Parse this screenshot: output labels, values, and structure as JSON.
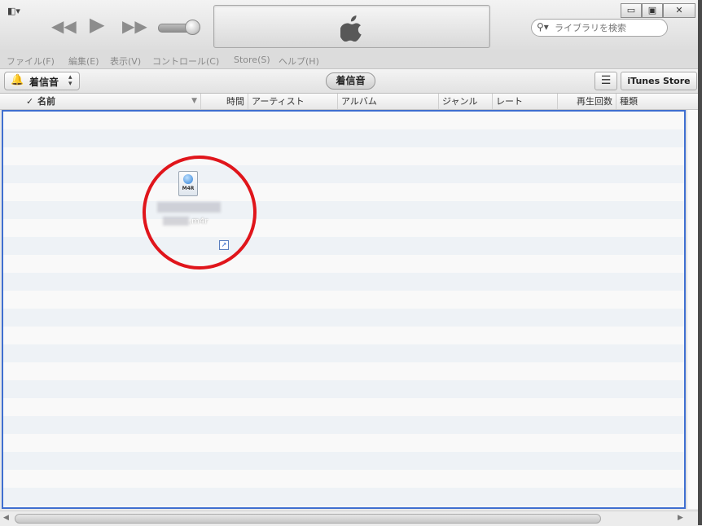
{
  "toolbar": {
    "sidebar_toggle": "◧▾",
    "window_controls": {
      "minimize": "▭",
      "restore": "▣",
      "close": "✕"
    },
    "search": {
      "placeholder": "ライブラリを検索"
    }
  },
  "menu": [
    "ファイル(F)",
    "編集(E)",
    "表示(V)",
    "コントロール(C)",
    "Store(S)",
    "ヘルプ(H)"
  ],
  "bar2": {
    "media_select": "着信音",
    "center_pill": "着信音",
    "store_button": "iTunes Store"
  },
  "columns": {
    "check": "✓",
    "name": "名前",
    "time": "時間",
    "artist": "アーティスト",
    "album": "アルバム",
    "genre": "ジャンル",
    "rating": "レート",
    "play_count": "再生回数",
    "kind": "種類"
  },
  "dragged_file": {
    "type_badge": "M4R",
    "filename_suffix": ".m4r"
  },
  "colors": {
    "highlight_circle": "#e0151b",
    "list_border": "#3f6fd0",
    "row_alt": "#eef2f6"
  },
  "icons": {
    "play": "play-icon",
    "rewind": "rewind-icon",
    "forward": "fast-forward-icon",
    "apple": "apple-logo-icon",
    "search": "search-icon",
    "bell": "bell-icon",
    "list": "list-view-icon"
  }
}
